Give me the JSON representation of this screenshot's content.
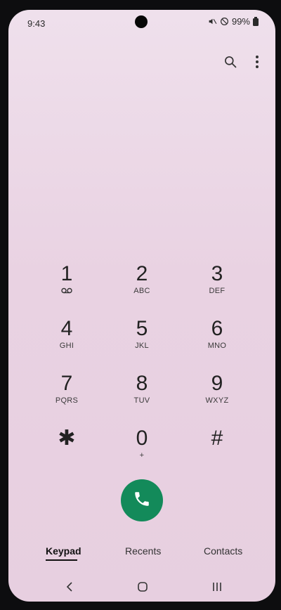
{
  "status_bar": {
    "time": "9:43",
    "battery": "99%",
    "icons": [
      "mute-icon",
      "do-not-disturb-icon",
      "battery-icon"
    ]
  },
  "actions": {
    "icons": [
      "search-icon",
      "more-options-icon"
    ]
  },
  "keypad": {
    "keys": [
      {
        "digit": "1",
        "letters": ""
      },
      {
        "digit": "2",
        "letters": "ABC"
      },
      {
        "digit": "3",
        "letters": "DEF"
      },
      {
        "digit": "4",
        "letters": "GHI"
      },
      {
        "digit": "5",
        "letters": "JKL"
      },
      {
        "digit": "6",
        "letters": "MNO"
      },
      {
        "digit": "7",
        "letters": "PQRS"
      },
      {
        "digit": "8",
        "letters": "TUV"
      },
      {
        "digit": "9",
        "letters": "WXYZ"
      },
      {
        "digit": "✱",
        "letters": ""
      },
      {
        "digit": "0",
        "letters": "+"
      },
      {
        "digit": "#",
        "letters": ""
      }
    ]
  },
  "tabs": [
    {
      "label": "Keypad",
      "active": true
    },
    {
      "label": "Recents",
      "active": false
    },
    {
      "label": "Contacts",
      "active": false
    }
  ],
  "colors": {
    "call_button": "#138a5a",
    "screen_bg": "#e9d2e2"
  }
}
